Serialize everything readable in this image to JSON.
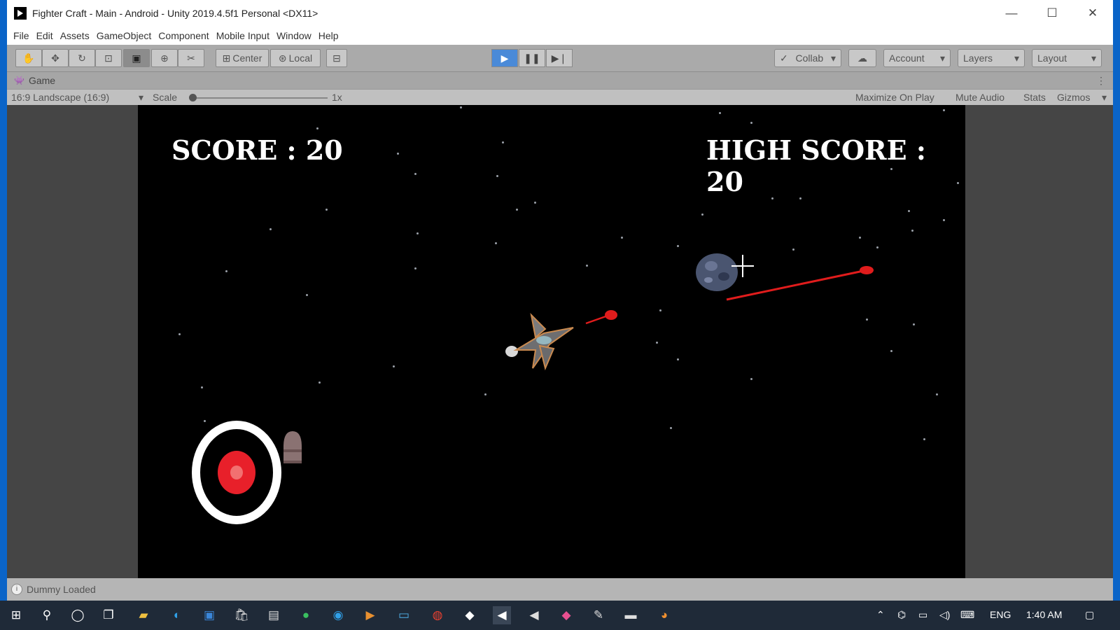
{
  "window": {
    "title": "Fighter Craft - Main - Android - Unity 2019.4.5f1 Personal <DX11>",
    "controls": [
      "minimize",
      "maximize",
      "close"
    ]
  },
  "menu": [
    "File",
    "Edit",
    "Assets",
    "GameObject",
    "Component",
    "Mobile Input",
    "Window",
    "Help"
  ],
  "toolbar": {
    "tools": [
      "hand-icon",
      "move-icon",
      "rotate-icon",
      "scale-icon",
      "rect-icon",
      "transform-icon",
      "custom-tool-icon"
    ],
    "pivot_label": "Center",
    "space_label": "Local",
    "collab_label": "Collab",
    "account_label": "Account",
    "layers_label": "Layers",
    "layout_label": "Layout"
  },
  "game_tab": {
    "label": "Game"
  },
  "game_bar": {
    "aspect": "16:9 Landscape (16:9)",
    "scale_label": "Scale",
    "scale_value": "1x",
    "maximize": "Maximize On Play",
    "mute": "Mute Audio",
    "stats": "Stats",
    "gizmos": "Gizmos"
  },
  "game": {
    "score": "SCORE : 20",
    "high_score": "HIGH SCORE : 20"
  },
  "status": {
    "message": "Dummy Loaded"
  },
  "taskbar": {
    "lang": "ENG",
    "time": "1:40 AM"
  },
  "colors": {
    "accent": "#1f6fd0",
    "laser": "#e01c1c",
    "fire_button": "#e8202a"
  }
}
